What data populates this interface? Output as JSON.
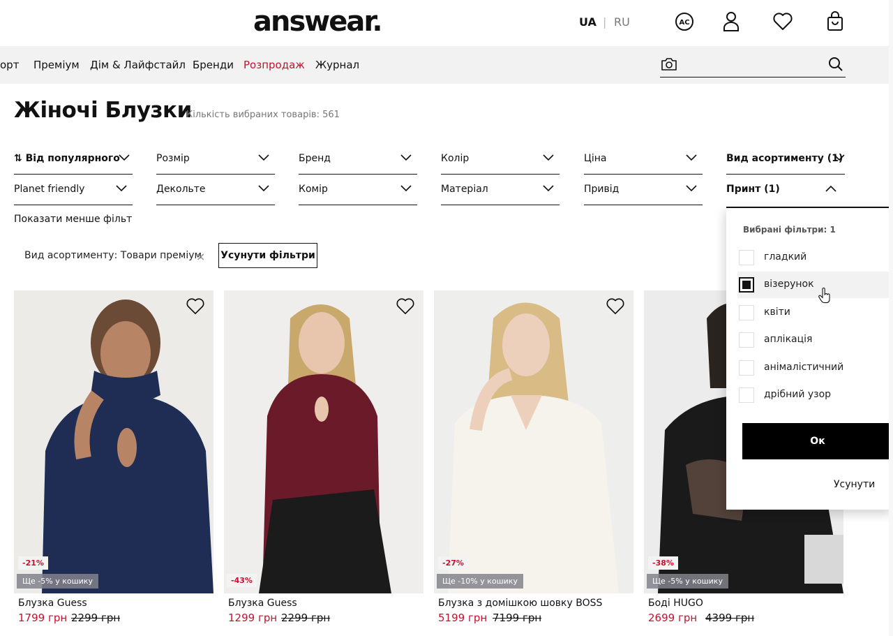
{
  "header": {
    "logo": "answear.",
    "lang_active": "UA",
    "lang_sep": "|",
    "lang_other": "RU",
    "ac_label": "AC"
  },
  "nav": {
    "items": [
      "орт",
      "Преміум",
      "Дім & Лайфстайл",
      "Бренди",
      "Розпродаж",
      "Журнал"
    ],
    "sale_color": "#c8102e"
  },
  "page": {
    "title": "Жіночі Блузки",
    "count_text": "Кількість вибраних товарів: 561"
  },
  "filters": {
    "sort": "Від популярного",
    "size": "Розмір",
    "brand": "Бренд",
    "color": "Колір",
    "price": "Ціна",
    "range": "Вид асортименту (1)",
    "planet": "Planet friendly",
    "neckline": "Декольте",
    "collar": "Комір",
    "material": "Матеріал",
    "closure": "Привід",
    "print": "Принт (1)",
    "show_less": "Показати менше фільтрів"
  },
  "active_filter": {
    "label": "Вид асортименту: Товари преміум",
    "remove": "×",
    "clear_button": "Усунути фільтри"
  },
  "dropdown": {
    "heading": "Вибрані фільтри: 1",
    "options": [
      {
        "label": "гладкий",
        "checked": false
      },
      {
        "label": "візерунок",
        "checked": true
      },
      {
        "label": "квіти",
        "checked": false
      },
      {
        "label": "аплікація",
        "checked": false
      },
      {
        "label": "анімалістичний",
        "checked": false
      },
      {
        "label": "дрібний узор",
        "checked": false
      }
    ],
    "ok": "Ок",
    "reset": "Усунути"
  },
  "products": [
    {
      "name": "Блузка Guess",
      "discount": "-21%",
      "extra": "Ще -5% у кошику",
      "price": "1799 грн",
      "old_price": "2299 грн",
      "color": "#1f2d55"
    },
    {
      "name": "Блузка Guess",
      "discount": "",
      "extra": "-43%",
      "price": "1299 грн",
      "old_price": "2299 грн",
      "color": "#6b1a2a"
    },
    {
      "name": "Блузка з домішкою шовку BOSS",
      "discount": "-27%",
      "extra": "Ще -10% у кошику",
      "price": "5199 грн",
      "old_price": "7199 грн",
      "color": "#f2efe8"
    },
    {
      "name": "Боді HUGO",
      "discount": "-38%",
      "extra": "Ще -5% у кошику",
      "price": "2699 грн",
      "old_price": "4399 грн",
      "color": "#1a1a1a"
    }
  ]
}
